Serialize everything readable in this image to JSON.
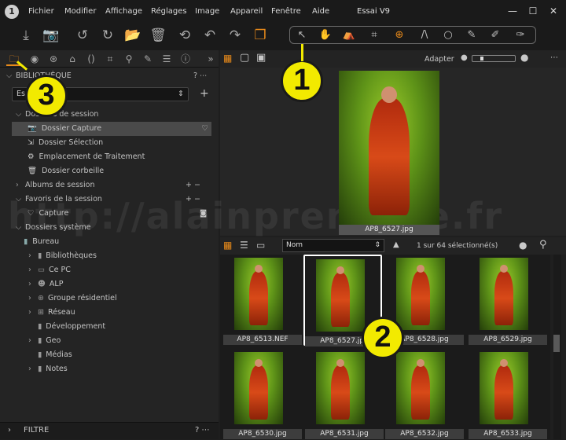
{
  "app": {
    "icon_label": "1",
    "window_title": "Essai V9"
  },
  "menu": [
    "Fichier",
    "Modifier",
    "Affichage",
    "Réglages",
    "Image",
    "Appareil",
    "Fenêtre",
    "Aide"
  ],
  "window_controls": [
    "—",
    "☐",
    "✕"
  ],
  "toolbar": {
    "left_icons": [
      {
        "name": "import-icon",
        "glyph": "⤓"
      },
      {
        "name": "camera-capture-icon",
        "glyph": "📷"
      },
      {
        "name": "rotate-left-icon",
        "glyph": "↺"
      },
      {
        "name": "rotate-right-icon",
        "glyph": "↻"
      },
      {
        "name": "move-to-folder-icon",
        "glyph": "📂"
      },
      {
        "name": "trash-icon",
        "glyph": "🗑"
      },
      {
        "name": "undo-all-icon",
        "glyph": "⟲"
      },
      {
        "name": "undo-icon",
        "glyph": "↶"
      },
      {
        "name": "redo-icon",
        "glyph": "↷"
      },
      {
        "name": "variants-icon",
        "glyph": "❐"
      }
    ],
    "cursor_tools": [
      {
        "name": "select-cursor-icon",
        "glyph": "↖"
      },
      {
        "name": "pan-hand-icon",
        "glyph": "✋"
      },
      {
        "name": "loupe-icon",
        "glyph": "⛺"
      },
      {
        "name": "crop-icon",
        "glyph": "⌗"
      },
      {
        "name": "rotate-tool-icon",
        "glyph": "⊕"
      },
      {
        "name": "keystone-icon",
        "glyph": "/\\"
      },
      {
        "name": "circle-spot-icon",
        "glyph": "○"
      },
      {
        "name": "brush-icon",
        "glyph": "✎"
      },
      {
        "name": "eyedropper-icon",
        "glyph": "✐"
      },
      {
        "name": "annotate-icon",
        "glyph": "✑"
      }
    ]
  },
  "tool_tabs": [
    {
      "name": "tab-library-folder",
      "glyph": "🗀"
    },
    {
      "name": "tab-capture",
      "glyph": "◉"
    },
    {
      "name": "tab-color",
      "glyph": "⊛"
    },
    {
      "name": "tab-exposure",
      "glyph": "⌂"
    },
    {
      "name": "tab-lens",
      "glyph": "()"
    },
    {
      "name": "tab-composition",
      "glyph": "⌗"
    },
    {
      "name": "tab-details",
      "glyph": "⚲"
    },
    {
      "name": "tab-local-adjust",
      "glyph": "✎"
    },
    {
      "name": "tab-output",
      "glyph": "☰"
    },
    {
      "name": "tab-metadata",
      "glyph": "ⓘ"
    }
  ],
  "library": {
    "header": "BIBLIOTHÈQUE",
    "session_value": "Essai V9",
    "session_folders_label": "Dossiers de session",
    "session_folders": [
      {
        "label": "Dossier Capture",
        "icon": "📷",
        "active": true
      },
      {
        "label": "Dossier Sélection",
        "icon": "⇲",
        "active": false
      },
      {
        "label": "Emplacement de Traitement",
        "icon": "⚙",
        "active": false
      },
      {
        "label": "Dossier corbeille",
        "icon": "🗑",
        "active": false
      }
    ],
    "albums_label": "Albums de session",
    "favorites_label": "Favoris de la session",
    "favorites": [
      {
        "label": "Capture"
      }
    ],
    "system_label": "Dossiers système",
    "system_root": "Bureau",
    "system_folders": [
      "Bibliothèques",
      "Ce PC",
      "ALP",
      "Groupe résidentiel",
      "Réseau",
      "Développement",
      "Geo",
      "Médias",
      "Notes"
    ],
    "filter_label": "FILTRE"
  },
  "viewer": {
    "fit_label": "Adapter",
    "main_image_label": "AP8_6527.jpg"
  },
  "browser": {
    "sort_value": "Nom",
    "selection_status": "1 sur 64 sélectionné(s)",
    "thumbnails": [
      {
        "label": "AP8_6513.NEF",
        "selected": false
      },
      {
        "label": "AP8_6527.jpg",
        "selected": true
      },
      {
        "label": "AP8_6528.jpg",
        "selected": false
      },
      {
        "label": "AP8_6529.jpg",
        "selected": false
      },
      {
        "label": "AP8_6530.jpg",
        "selected": false
      },
      {
        "label": "AP8_6531.jpg",
        "selected": false
      },
      {
        "label": "AP8_6532.jpg",
        "selected": false
      },
      {
        "label": "AP8_6533.jpg",
        "selected": false
      }
    ]
  },
  "annotations": [
    "1",
    "2",
    "3"
  ],
  "watermark": "http://alainpreneree.fr",
  "colors": {
    "accent": "#e88a1a",
    "badge": "#f2ea00",
    "selection": "#ffffff"
  }
}
